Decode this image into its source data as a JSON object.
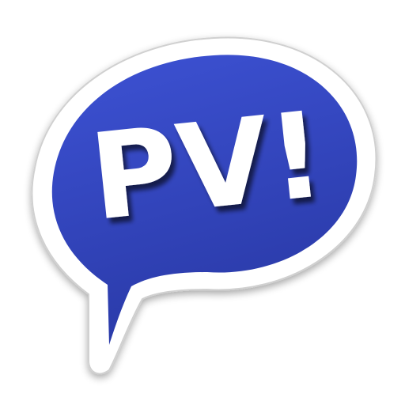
{
  "icon": {
    "name": "speech-bubble-icon",
    "logo_text": "PV!",
    "colors": {
      "bubble_fill": "#3548c7",
      "bubble_fill_light": "#3d52d4",
      "bubble_fill_dark": "#2a3aa8",
      "border": "#ffffff",
      "outline": "#d0d0d0",
      "text": "#ffffff",
      "shadow": "#000000"
    }
  }
}
